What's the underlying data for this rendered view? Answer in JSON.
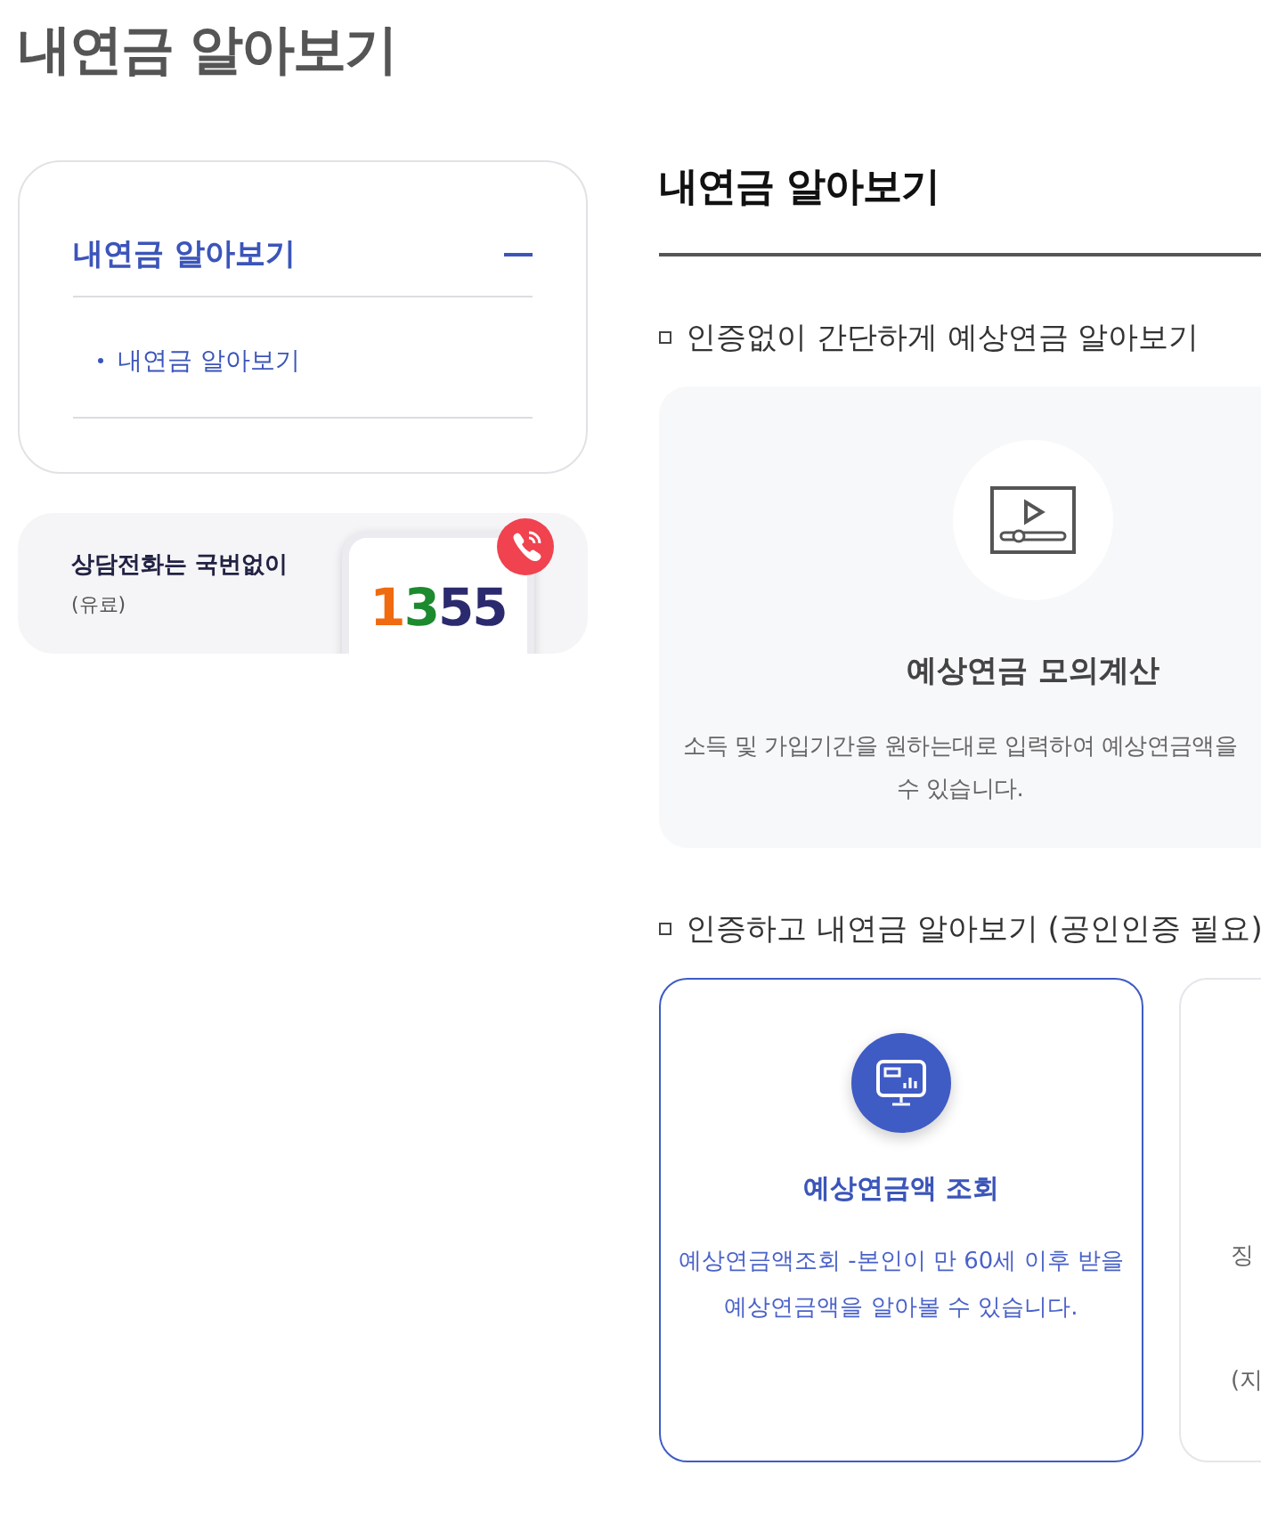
{
  "page_title": "내연금 알아보기",
  "sidebar": {
    "menu": {
      "label": "내연금 알아보기",
      "expanded": true,
      "children": [
        {
          "label": "내연금 알아보기",
          "selected": true
        }
      ]
    },
    "banner": {
      "text": "상담전화는 국번없이",
      "note": "(유료)",
      "number_parts": [
        {
          "text": "1",
          "color": "#f06a0f"
        },
        {
          "text": "3",
          "color": "#1c8a2e"
        },
        {
          "text": "55",
          "color": "#2b2a6e"
        }
      ]
    }
  },
  "main": {
    "heading": "내연금 알아보기",
    "sections": [
      {
        "title": "인증없이 간단하게 예상연금 알아보기",
        "cards": [
          {
            "kind": "plain",
            "title": "예상연금 모의계산",
            "lines": [
              "소득 및 가입기간을 원하는대로 입력하여 예상연금액을",
              "수 있습니다."
            ]
          }
        ]
      },
      {
        "title": "인증하고 내연금 알아보기 (공인인증 필요)",
        "cards": [
          {
            "kind": "highlight",
            "title": "예상연금액 조회",
            "lines": [
              "예상연금액조회 -본인이 만 60세 이후 받을",
              "예상연금액을 알아볼 수 있습니다."
            ]
          },
          {
            "kind": "partial",
            "lines": [
              "징",
              "(지"
            ]
          }
        ]
      }
    ]
  }
}
